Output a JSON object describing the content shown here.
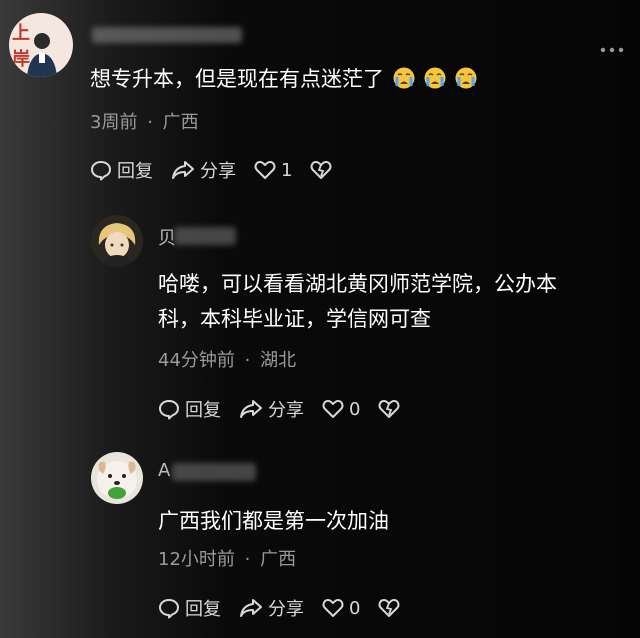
{
  "comment": {
    "avatar_text": "上岸",
    "text": "想专升本，但是现在有点迷茫了",
    "emojis": [
      "crying-face",
      "crying-face",
      "crying-face"
    ],
    "time": "3周前",
    "location": "广西",
    "reply_label": "回复",
    "share_label": "分享",
    "like_count": "1"
  },
  "replies": [
    {
      "username_initial": "贝",
      "text_line1": "哈喽，可以看看湖北黄冈师范学院，公办本",
      "text_line2": "科，本科毕业证，学信网可查",
      "time": "44分钟前",
      "location": "湖北",
      "reply_label": "回复",
      "share_label": "分享",
      "like_count": "0"
    },
    {
      "username_initial": "A",
      "text": "广西我们都是第一次加油",
      "time": "12小时前",
      "location": "广西",
      "reply_label": "回复",
      "share_label": "分享",
      "like_count": "0"
    }
  ],
  "separator": "·",
  "colors": {
    "meta": "#9a9a9a",
    "emoji_yellow": "#f7c53a",
    "avatar_bg": "#f3e7df",
    "avatar_text": "#c0392b"
  }
}
